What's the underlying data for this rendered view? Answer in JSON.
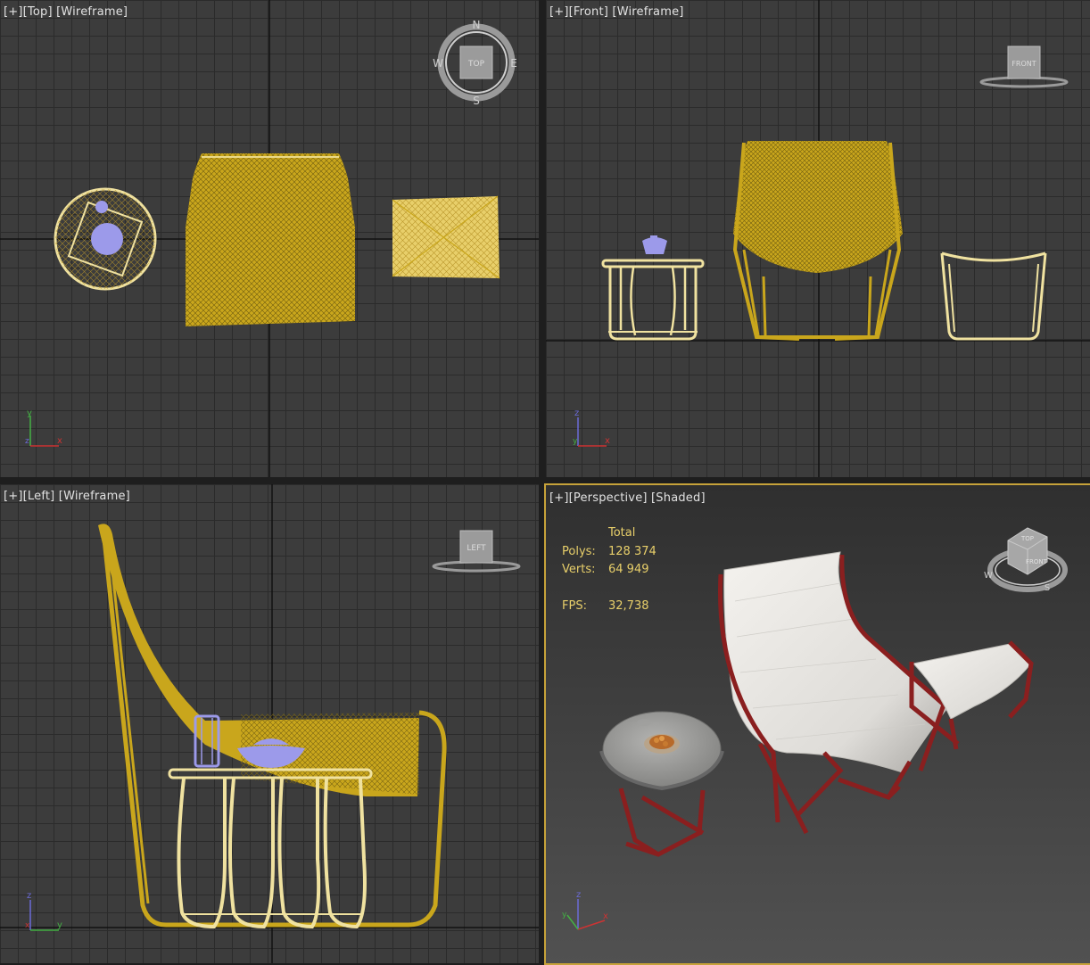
{
  "viewports": {
    "top": {
      "bracket_plus": "[+]",
      "view": "[Top]",
      "mode": "[Wireframe]",
      "cube_label": "TOP",
      "compass": {
        "n": "N",
        "s": "S",
        "e": "E",
        "w": "W"
      },
      "axis": {
        "y": "y",
        "x": "x",
        "z": "z"
      }
    },
    "front": {
      "bracket_plus": "[+]",
      "view": "[Front]",
      "mode": "[Wireframe]",
      "cube_label": "FRONT",
      "axis": {
        "z": "z",
        "x": "x",
        "y": "y"
      }
    },
    "left": {
      "bracket_plus": "[+]",
      "view": "[Left]",
      "mode": "[Wireframe]",
      "cube_label": "LEFT",
      "axis": {
        "z": "z",
        "y": "y",
        "x": "x"
      }
    },
    "perspective": {
      "bracket_plus": "[+]",
      "view": "[Perspective]",
      "mode": "[Shaded]",
      "cube_top": "TOP",
      "cube_front": "FRONT",
      "compass": {
        "w": "W",
        "s": "S"
      },
      "axis": {
        "z": "z",
        "y": "y",
        "x": "x"
      }
    }
  },
  "stats": {
    "header": "Total",
    "polys_label": "Polys:",
    "polys_value": "128 374",
    "verts_label": "Verts:",
    "verts_value": "64 949",
    "fps_label": "FPS:",
    "fps_value": "32,738"
  },
  "colors": {
    "wire_gold": "#c9a61c",
    "wire_light": "#f0e2a0",
    "selection_blue": "#9c9aea",
    "active_border": "#c6a23a",
    "frame_red": "#8a1f1f",
    "fabric_white": "#e6e4e0",
    "table_grey": "#9a9a98"
  }
}
